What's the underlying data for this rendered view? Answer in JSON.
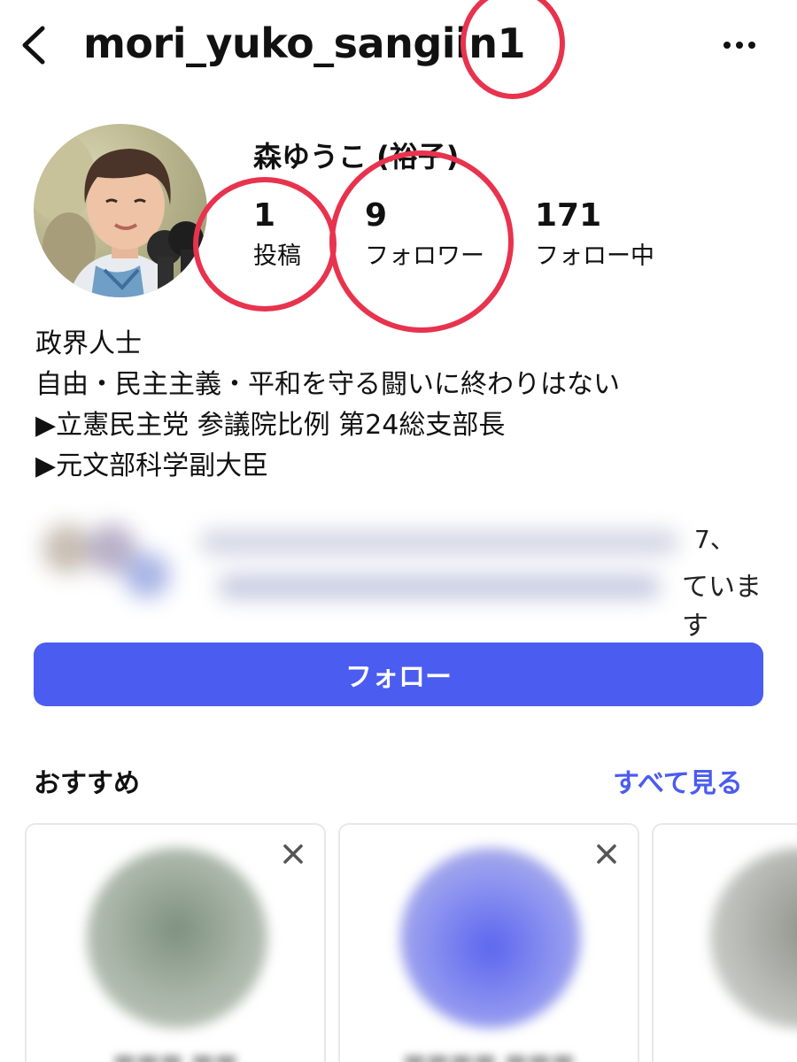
{
  "header": {
    "username": "mori_yuko_sangiin1"
  },
  "profile": {
    "display_name": "森ゆうこ (裕子)",
    "stats": {
      "posts": {
        "value": "1",
        "label": "投稿"
      },
      "followers": {
        "value": "9",
        "label": "フォロワー"
      },
      "following": {
        "value": "171",
        "label": "フォロー中"
      }
    },
    "bio": [
      "政界人士",
      "自由・民主主義・平和を守る闘いに終わりはない",
      "▶立憲民主党 参議院比例 第24総支部長",
      "▶元文部科学副大臣"
    ],
    "mutual_followers_tail": [
      "7、",
      "ています"
    ]
  },
  "actions": {
    "follow_label": "フォロー"
  },
  "suggestions": {
    "title": "おすすめ",
    "see_all_label": "すべて見る"
  },
  "icons": {
    "back": "chevron-left-icon",
    "more": "more-horizontal-icon",
    "close": "close-icon"
  },
  "colors": {
    "accent": "#4b5cf0",
    "annotation": "#e8334e",
    "text": "#111111"
  }
}
